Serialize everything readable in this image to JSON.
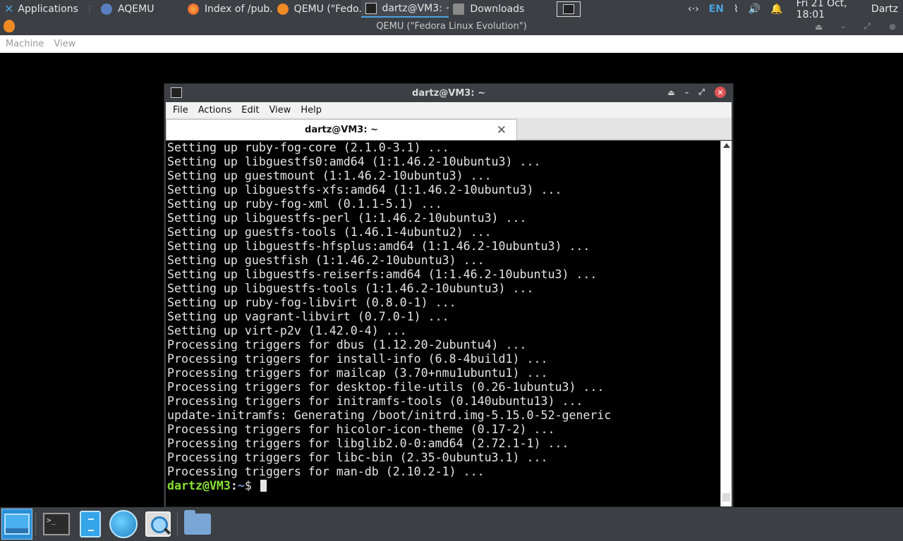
{
  "top_panel": {
    "applications_label": "Applications",
    "tasks": [
      {
        "label": "AQEMU",
        "icon": "aqemu-icon"
      },
      {
        "label": "Index of /pub...",
        "icon": "firefox-icon"
      },
      {
        "label": "QEMU (\"Fedo...",
        "icon": "qemu-icon"
      },
      {
        "label": "dartz@VM3: ~",
        "icon": "terminal-icon"
      },
      {
        "label": "Downloads",
        "icon": "folder-icon"
      }
    ],
    "language": "EN",
    "clock": "Fri 21 Oct, 18:01",
    "user": "Dartz"
  },
  "qemu_window": {
    "title": "QEMU (\"Fedora Linux Evolution\")",
    "menu": [
      "Machine",
      "View"
    ]
  },
  "terminal_window": {
    "title": "dartz@VM3: ~",
    "menu": [
      "File",
      "Actions",
      "Edit",
      "View",
      "Help"
    ],
    "tab_label": "dartz@VM3: ~",
    "lines": [
      "Setting up ruby-fog-core (2.1.0-3.1) ...",
      "Setting up libguestfs0:amd64 (1:1.46.2-10ubuntu3) ...",
      "Setting up guestmount (1:1.46.2-10ubuntu3) ...",
      "Setting up libguestfs-xfs:amd64 (1:1.46.2-10ubuntu3) ...",
      "Setting up ruby-fog-xml (0.1.1-5.1) ...",
      "Setting up libguestfs-perl (1:1.46.2-10ubuntu3) ...",
      "Setting up guestfs-tools (1.46.1-4ubuntu2) ...",
      "Setting up libguestfs-hfsplus:amd64 (1:1.46.2-10ubuntu3) ...",
      "Setting up guestfish (1:1.46.2-10ubuntu3) ...",
      "Setting up libguestfs-reiserfs:amd64 (1:1.46.2-10ubuntu3) ...",
      "Setting up libguestfs-tools (1:1.46.2-10ubuntu3) ...",
      "Setting up ruby-fog-libvirt (0.8.0-1) ...",
      "Setting up vagrant-libvirt (0.7.0-1) ...",
      "Setting up virt-p2v (1.42.0-4) ...",
      "Processing triggers for dbus (1.12.20-2ubuntu4) ...",
      "Processing triggers for install-info (6.8-4build1) ...",
      "Processing triggers for mailcap (3.70+nmu1ubuntu1) ...",
      "Processing triggers for desktop-file-utils (0.26-1ubuntu3) ...",
      "Processing triggers for initramfs-tools (0.140ubuntu13) ...",
      "update-initramfs: Generating /boot/initrd.img-5.15.0-52-generic",
      "Processing triggers for hicolor-icon-theme (0.17-2) ...",
      "Processing triggers for libglib2.0-0:amd64 (2.72.1-1) ...",
      "Processing triggers for libc-bin (2.35-0ubuntu3.1) ...",
      "Processing triggers for man-db (2.10.2-1) ..."
    ],
    "prompt_user": "dartz@VM3",
    "prompt_path": "~",
    "prompt_symbol": "$"
  },
  "dock": {
    "items": [
      "show-desktop-icon",
      "terminal-icon",
      "file-cabinet-icon",
      "web-browser-icon",
      "app-finder-icon",
      "home-folder-icon"
    ]
  },
  "colors": {
    "panel_bg": "#3c3f44",
    "accent": "#4aa3e0",
    "prompt_user": "#8ae234",
    "prompt_path": "#729fcf",
    "close_button": "#e05555"
  }
}
